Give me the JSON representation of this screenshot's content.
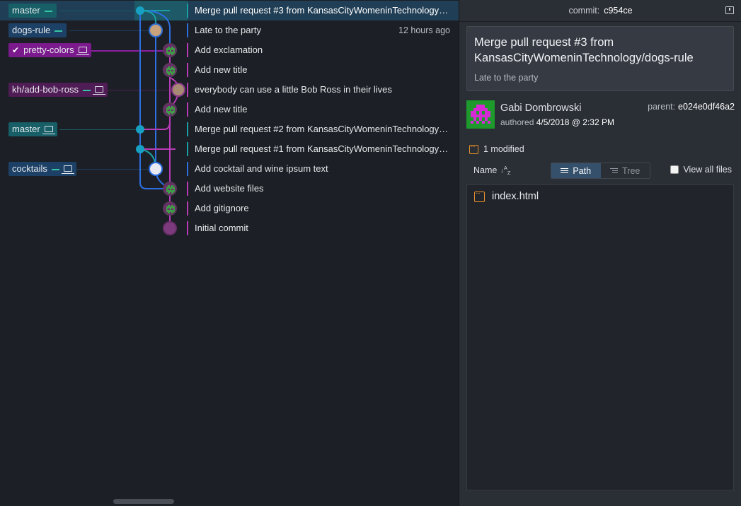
{
  "graph": {
    "commits": [
      {
        "message": "Merge pull request #3 from KansasCityWomeninTechnology/d...",
        "time": "",
        "selected": true,
        "accent": "#18a0a6"
      },
      {
        "message": "Late to the party",
        "time": "12 hours ago",
        "selected": false,
        "accent": "#2d6fe0"
      },
      {
        "message": "Add exclamation",
        "time": "",
        "selected": false,
        "accent": "#b83bb8"
      },
      {
        "message": "Add new title",
        "time": "",
        "selected": false,
        "accent": "#b83bb8"
      },
      {
        "message": "everybody can use a little Bob Ross in their lives",
        "time": "",
        "selected": false,
        "accent": "#b83bb8"
      },
      {
        "message": "Add new title",
        "time": "",
        "selected": false,
        "accent": "#b83bb8"
      },
      {
        "message": "Merge pull request #2 from KansasCityWomeninTechnology/c...",
        "time": "",
        "selected": false,
        "accent": "#18a0a6"
      },
      {
        "message": "Merge pull request #1 from KansasCityWomeninTechnology/k...",
        "time": "",
        "selected": false,
        "accent": "#18a0a6"
      },
      {
        "message": "Add cocktail and wine ipsum text",
        "time": "",
        "selected": false,
        "accent": "#2d6fe0"
      },
      {
        "message": "Add website files",
        "time": "",
        "selected": false,
        "accent": "#b83bb8"
      },
      {
        "message": "Add gitignore",
        "time": "",
        "selected": false,
        "accent": "#b83bb8"
      },
      {
        "message": "Initial commit",
        "time": "",
        "selected": false,
        "accent": "#b83bb8"
      }
    ],
    "refs": {
      "master_top": "master",
      "dogs_rule": "dogs-rule",
      "pretty_colors": "pretty-colors",
      "kh_add_bob_ross": "kh/add-bob-ross",
      "master_local": "master",
      "cocktails": "cocktails"
    },
    "colors": {
      "teal": "#18a0a6",
      "blue": "#2d6fe0",
      "purple": "#b83bb8",
      "ref_teal": "#175e66",
      "ref_blue": "#1d4166",
      "ref_purple": "#5f1d66",
      "ref_checked": "#7a1a8c"
    }
  },
  "details": {
    "header_label": "commit:",
    "header_sha": "c954ce",
    "summary_title": "Merge pull request #3 from KansasCityWomeninTechnology/dogs-rule",
    "summary_body": "Late to the party",
    "author_name": "Gabi Dombrowski",
    "authored_label": "authored",
    "authored_date": "4/5/2018 @ 2:32 PM",
    "parent_label": "parent:",
    "parent_sha": "e024e0df46a2",
    "modified_label": "1 modified",
    "sort_label": "Name",
    "path_label": "Path",
    "tree_label": "Tree",
    "view_all_label": "View all files",
    "files": [
      "index.html"
    ]
  }
}
